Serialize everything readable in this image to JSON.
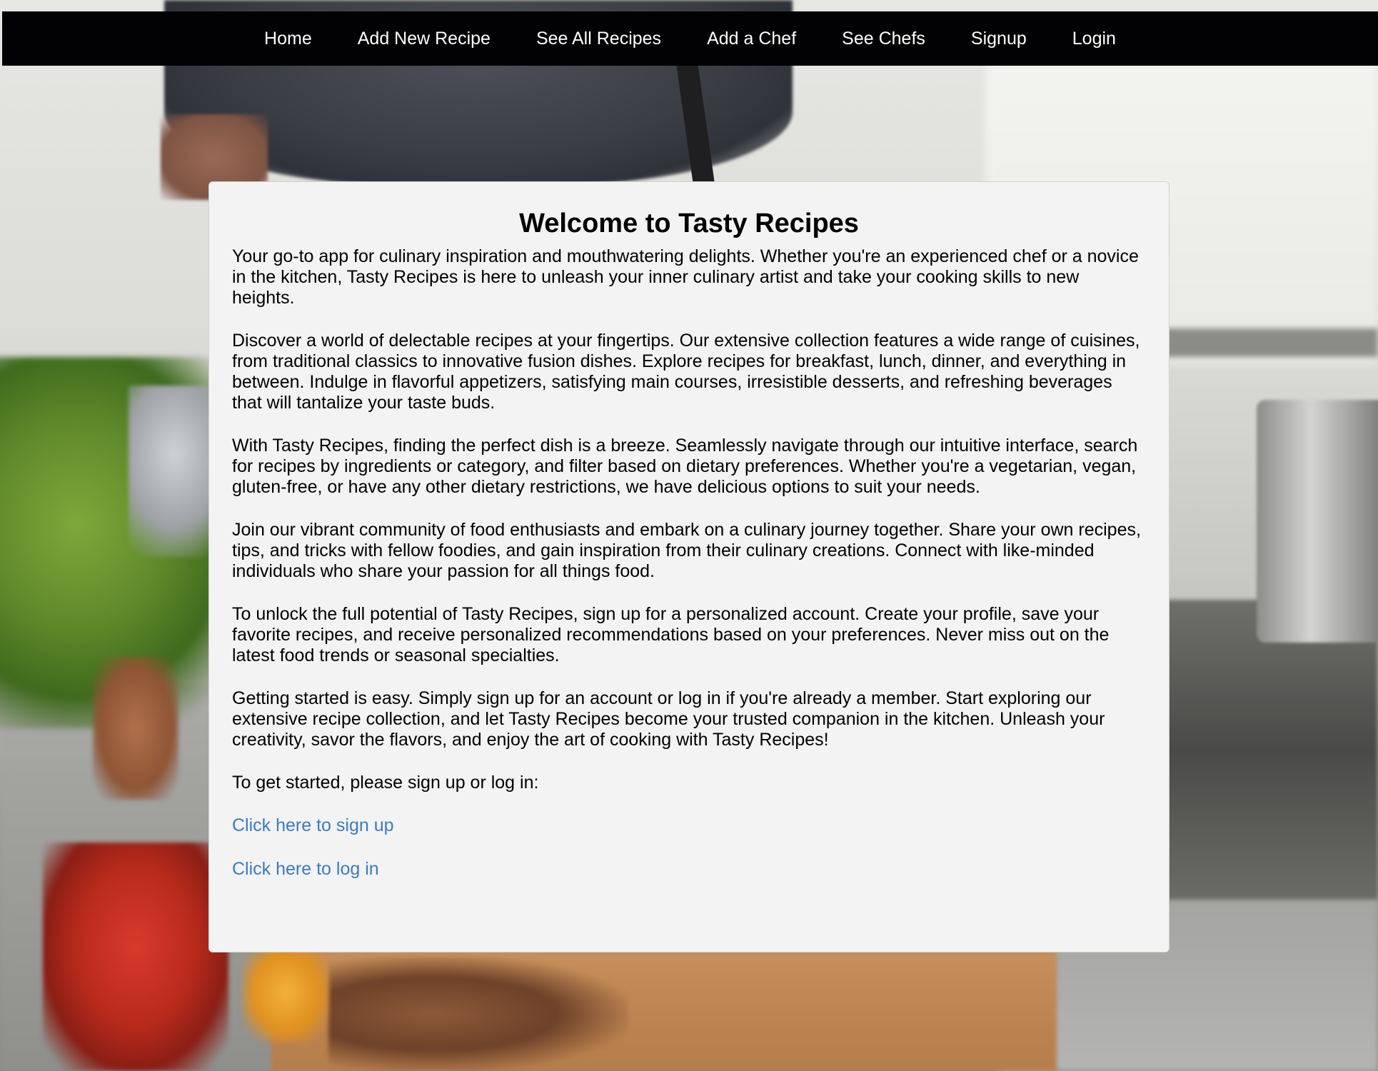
{
  "nav": {
    "items": [
      {
        "label": "Home"
      },
      {
        "label": "Add New Recipe"
      },
      {
        "label": "See All Recipes"
      },
      {
        "label": "Add a Chef"
      },
      {
        "label": "See Chefs"
      },
      {
        "label": "Signup"
      },
      {
        "label": "Login"
      }
    ]
  },
  "main": {
    "title": "Welcome to Tasty Recipes",
    "paragraphs": [
      "Your go-to app for culinary inspiration and mouthwatering delights. Whether you're an experienced chef or a novice in the kitchen, Tasty Recipes is here to unleash your inner culinary artist and take your cooking skills to new heights.",
      "Discover a world of delectable recipes at your fingertips. Our extensive collection features a wide range of cuisines, from traditional classics to innovative fusion dishes. Explore recipes for breakfast, lunch, dinner, and everything in between. Indulge in flavorful appetizers, satisfying main courses, irresistible desserts, and refreshing beverages that will tantalize your taste buds.",
      "With Tasty Recipes, finding the perfect dish is a breeze. Seamlessly navigate through our intuitive interface, search for recipes by ingredients or category, and filter based on dietary preferences. Whether you're a vegetarian, vegan, gluten-free, or have any other dietary restrictions, we have delicious options to suit your needs.",
      "Join our vibrant community of food enthusiasts and embark on a culinary journey together. Share your own recipes, tips, and tricks with fellow foodies, and gain inspiration from their culinary creations. Connect with like-minded individuals who share your passion for all things food.",
      "To unlock the full potential of Tasty Recipes, sign up for a personalized account. Create your profile, save your favorite recipes, and receive personalized recommendations based on your preferences. Never miss out on the latest food trends or seasonal specialties.",
      "Getting started is easy. Simply sign up for an account or log in if you're already a member. Start exploring our extensive recipe collection, and let Tasty Recipes become your trusted companion in the kitchen. Unleash your creativity, savor the flavors, and enjoy the art of cooking with Tasty Recipes!",
      "To get started, please sign up or log in:"
    ],
    "links": {
      "signup": "Click here to sign up",
      "login": "Click here to log in"
    }
  },
  "colors": {
    "navbar_bg": "#020204",
    "card_bg": "#f3f3f3",
    "link": "#3a7cbf"
  }
}
